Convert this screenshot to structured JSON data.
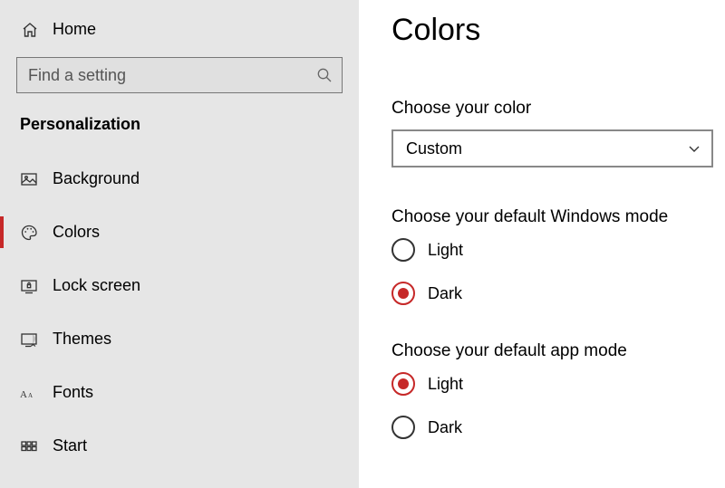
{
  "home_label": "Home",
  "search_placeholder": "Find a setting",
  "section_title": "Personalization",
  "nav": [
    {
      "label": "Background"
    },
    {
      "label": "Colors"
    },
    {
      "label": "Lock screen"
    },
    {
      "label": "Themes"
    },
    {
      "label": "Fonts"
    },
    {
      "label": "Start"
    }
  ],
  "page_title": "Colors",
  "color_label": "Choose your color",
  "color_value": "Custom",
  "windows_mode_label": "Choose your default Windows mode",
  "windows_mode": {
    "light": "Light",
    "dark": "Dark"
  },
  "app_mode_label": "Choose your default app mode",
  "app_mode": {
    "light": "Light",
    "dark": "Dark"
  }
}
